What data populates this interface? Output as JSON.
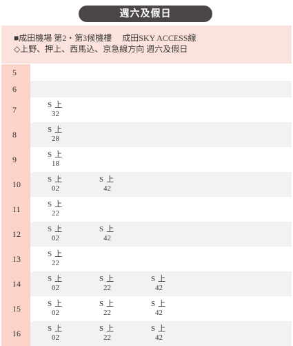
{
  "header": {
    "title": "週六及假日"
  },
  "info": {
    "line1": "■成田機場 第2・第3候機樓　 成田SKY ACCESS線",
    "line2": "◇上野、押上、西馬込、京急線方向 週六及假日"
  },
  "timetable": [
    {
      "hour": "5",
      "departures": []
    },
    {
      "hour": "6",
      "departures": []
    },
    {
      "hour": "7",
      "departures": [
        {
          "type": "S",
          "dest": "上",
          "minute": "32"
        }
      ]
    },
    {
      "hour": "8",
      "departures": [
        {
          "type": "S",
          "dest": "上",
          "minute": "28"
        }
      ]
    },
    {
      "hour": "9",
      "departures": [
        {
          "type": "S",
          "dest": "上",
          "minute": "18"
        }
      ]
    },
    {
      "hour": "10",
      "departures": [
        {
          "type": "S",
          "dest": "上",
          "minute": "02"
        },
        {
          "type": "S",
          "dest": "上",
          "minute": "42"
        }
      ]
    },
    {
      "hour": "11",
      "departures": [
        {
          "type": "S",
          "dest": "上",
          "minute": "22"
        }
      ]
    },
    {
      "hour": "12",
      "departures": [
        {
          "type": "S",
          "dest": "上",
          "minute": "02"
        },
        {
          "type": "S",
          "dest": "上",
          "minute": "42"
        }
      ]
    },
    {
      "hour": "13",
      "departures": [
        {
          "type": "S",
          "dest": "上",
          "minute": "22"
        }
      ]
    },
    {
      "hour": "14",
      "departures": [
        {
          "type": "S",
          "dest": "上",
          "minute": "02"
        },
        {
          "type": "S",
          "dest": "上",
          "minute": "22"
        },
        {
          "type": "S",
          "dest": "上",
          "minute": "42"
        }
      ]
    },
    {
      "hour": "15",
      "departures": [
        {
          "type": "S",
          "dest": "上",
          "minute": "02"
        },
        {
          "type": "S",
          "dest": "上",
          "minute": "22"
        },
        {
          "type": "S",
          "dest": "上",
          "minute": "42"
        }
      ]
    },
    {
      "hour": "16",
      "departures": [
        {
          "type": "S",
          "dest": "上",
          "minute": "02"
        },
        {
          "type": "S",
          "dest": "上",
          "minute": "22"
        },
        {
          "type": "S",
          "dest": "上",
          "minute": "42"
        }
      ]
    }
  ]
}
